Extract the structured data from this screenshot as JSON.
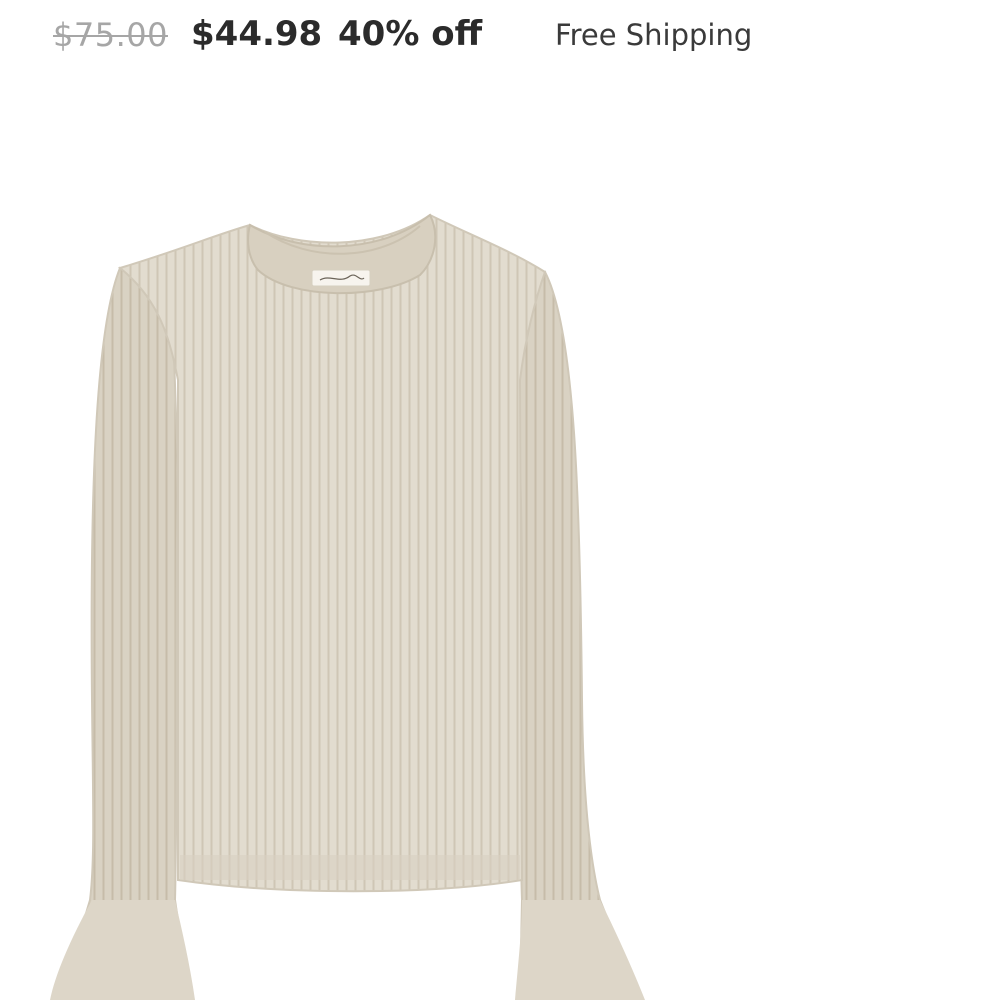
{
  "pricing": {
    "original_price": "$75.00",
    "sale_price": "$44.98",
    "discount": "40% off",
    "shipping": "Free Shipping"
  },
  "product": {
    "image_icon": "sweater-image",
    "colors": {
      "knit": "#e2dccf",
      "knit_shadow": "#cfc7b7",
      "rib_line": "#c9c0ae",
      "label": "#f7f4ee"
    }
  }
}
